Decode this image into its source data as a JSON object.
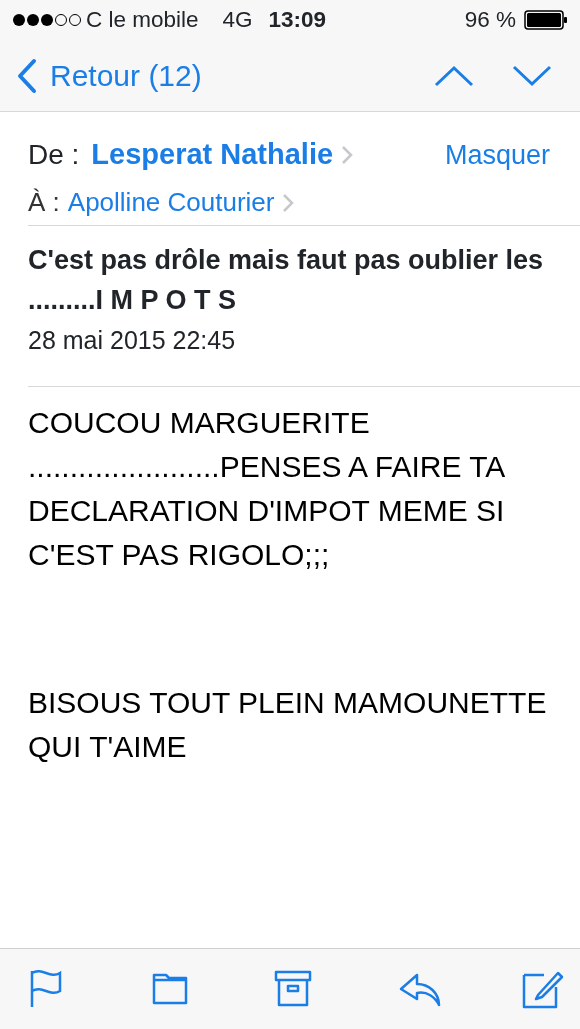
{
  "status_bar": {
    "carrier": "C le mobile",
    "network": "4G",
    "time": "13:09",
    "battery": "96 %"
  },
  "nav": {
    "back": "Retour (12)"
  },
  "header": {
    "from_label": "De :",
    "from": "Lesperat Nathalie",
    "hide": "Masquer",
    "to_label": "À :",
    "to": "Apolline Couturier"
  },
  "subject": "C'est pas drôle mais faut pas oublier les .........I M P O T S",
  "date": "28 mai 2015 22:45",
  "body": [
    {
      "text": "COUCOU MARGUERITE"
    },
    {
      "text": ".......................PENSES A FAIRE TA DECLARATION D'IMPOT MEME SI C'EST PAS RIGOLO;;;"
    },
    {
      "text": "BISOUS TOUT PLEIN MAMOUNETTE QUI T'AIME",
      "gap_before": true
    }
  ]
}
